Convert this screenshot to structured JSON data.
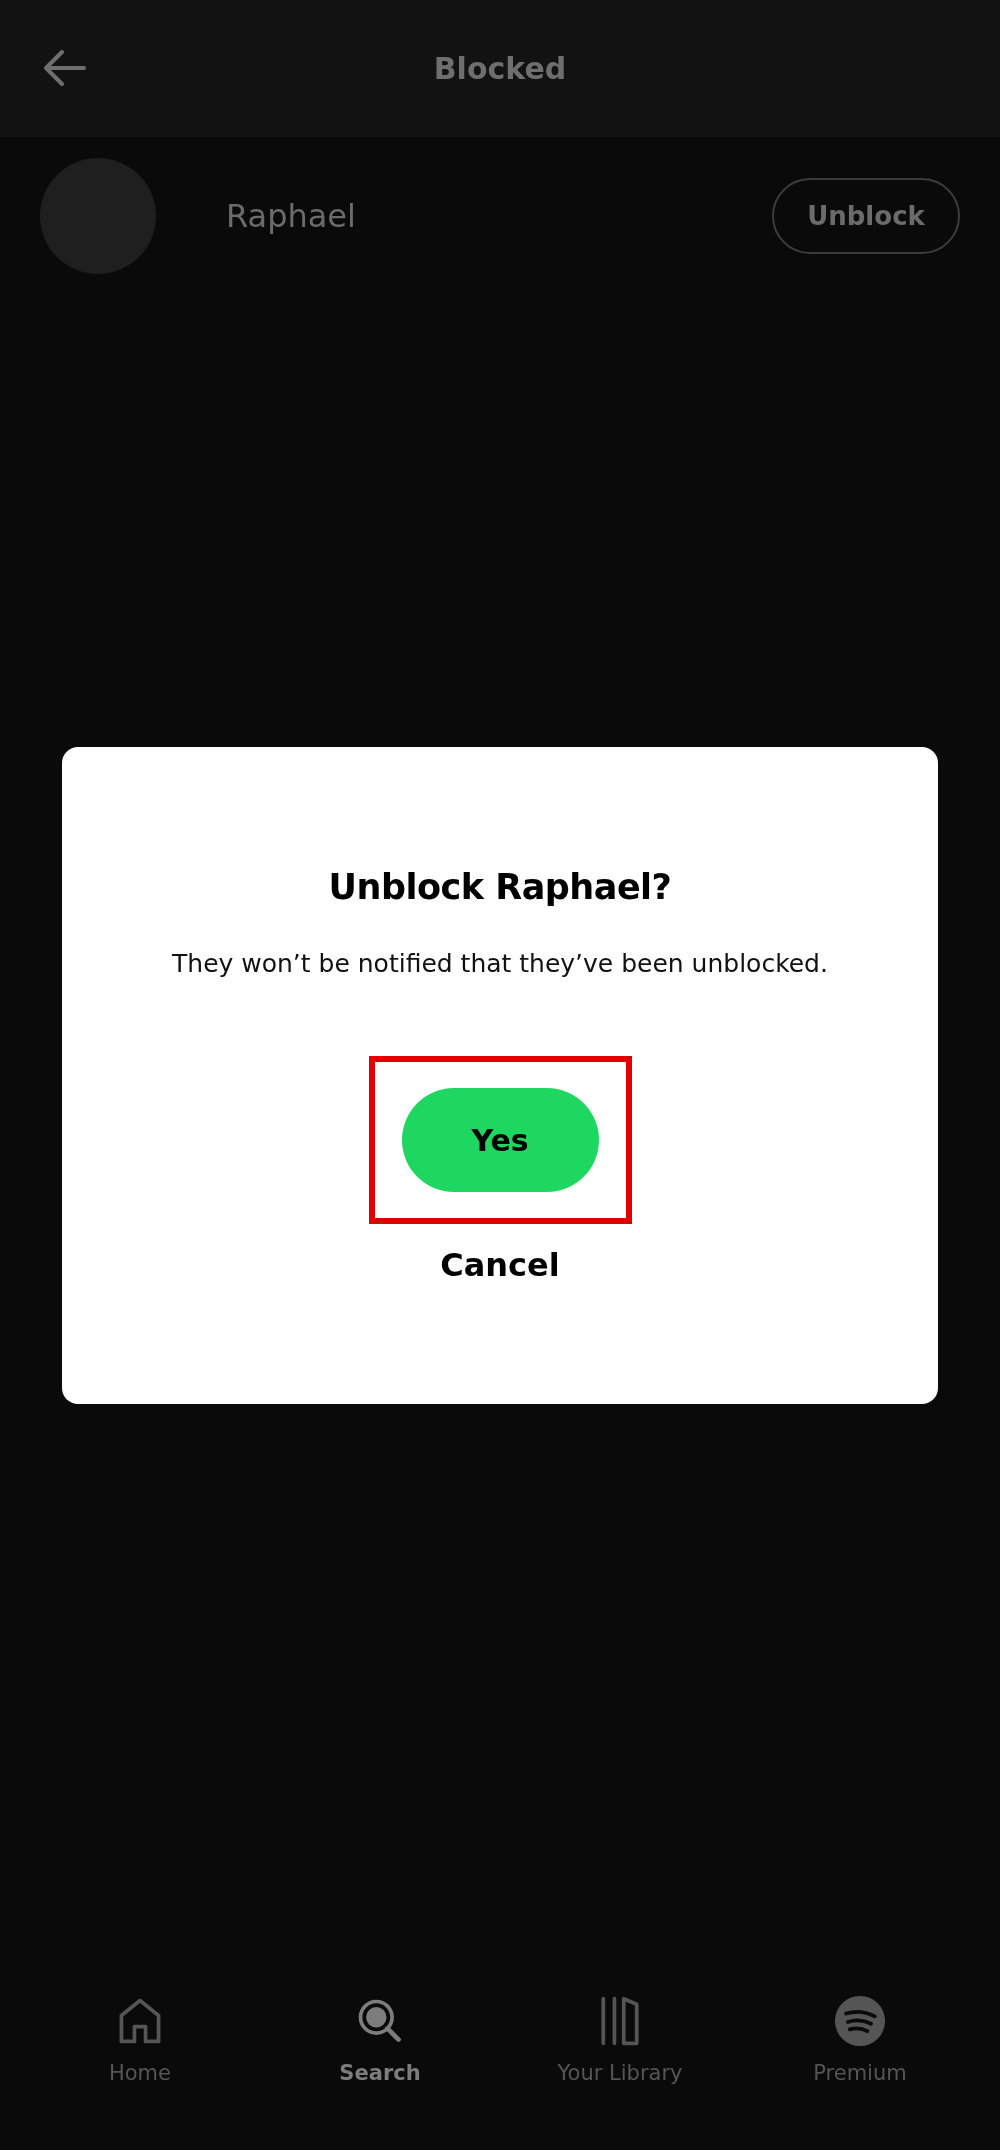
{
  "header": {
    "title": "Blocked"
  },
  "blocked_users": [
    {
      "name": "Raphael",
      "action": "Unblock"
    }
  ],
  "dialog": {
    "title": "Unblock Raphael?",
    "message": "They won’t be notified that they’ve been unblocked.",
    "confirm": "Yes",
    "confirm_highlighted": true,
    "cancel": "Cancel"
  },
  "nav": [
    {
      "label": "Home",
      "selected": false
    },
    {
      "label": "Search",
      "selected": true
    },
    {
      "label": "Your Library",
      "selected": false
    },
    {
      "label": "Premium",
      "selected": false
    }
  ]
}
